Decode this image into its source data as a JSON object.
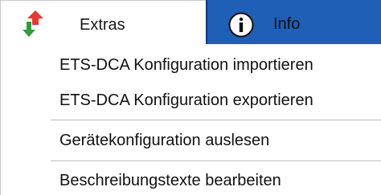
{
  "tabs": [
    {
      "label": "Extras",
      "icon": "up-down-arrows-icon",
      "active": true
    },
    {
      "label": "Info",
      "icon": "info-icon",
      "active": false
    }
  ],
  "menu": {
    "items": [
      {
        "label": "ETS-DCA Konfiguration importieren"
      },
      {
        "label": "ETS-DCA Konfiguration exportieren"
      },
      {
        "label": "Gerätekonfiguration auslesen"
      },
      {
        "label": "Beschreibungstexte bearbeiten"
      }
    ]
  },
  "colors": {
    "info_tab_bg": "#1f5fb5",
    "arrow_up": "#e53935",
    "arrow_down": "#2e9e3a"
  }
}
